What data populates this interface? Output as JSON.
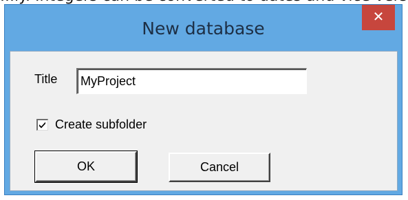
{
  "background_text": "...ly. Integers can be converted to dates and vice versa...",
  "dialog": {
    "title": "New database",
    "close_label": "✕",
    "title_field": {
      "label": "Title",
      "value": "MyProject"
    },
    "subfolder_checkbox": {
      "label": "Create subfolder",
      "checked": true
    },
    "ok_label": "OK",
    "cancel_label": "Cancel"
  },
  "colors": {
    "frame": "#62a9e3",
    "close": "#c7463d",
    "client": "#f0f0f0"
  }
}
